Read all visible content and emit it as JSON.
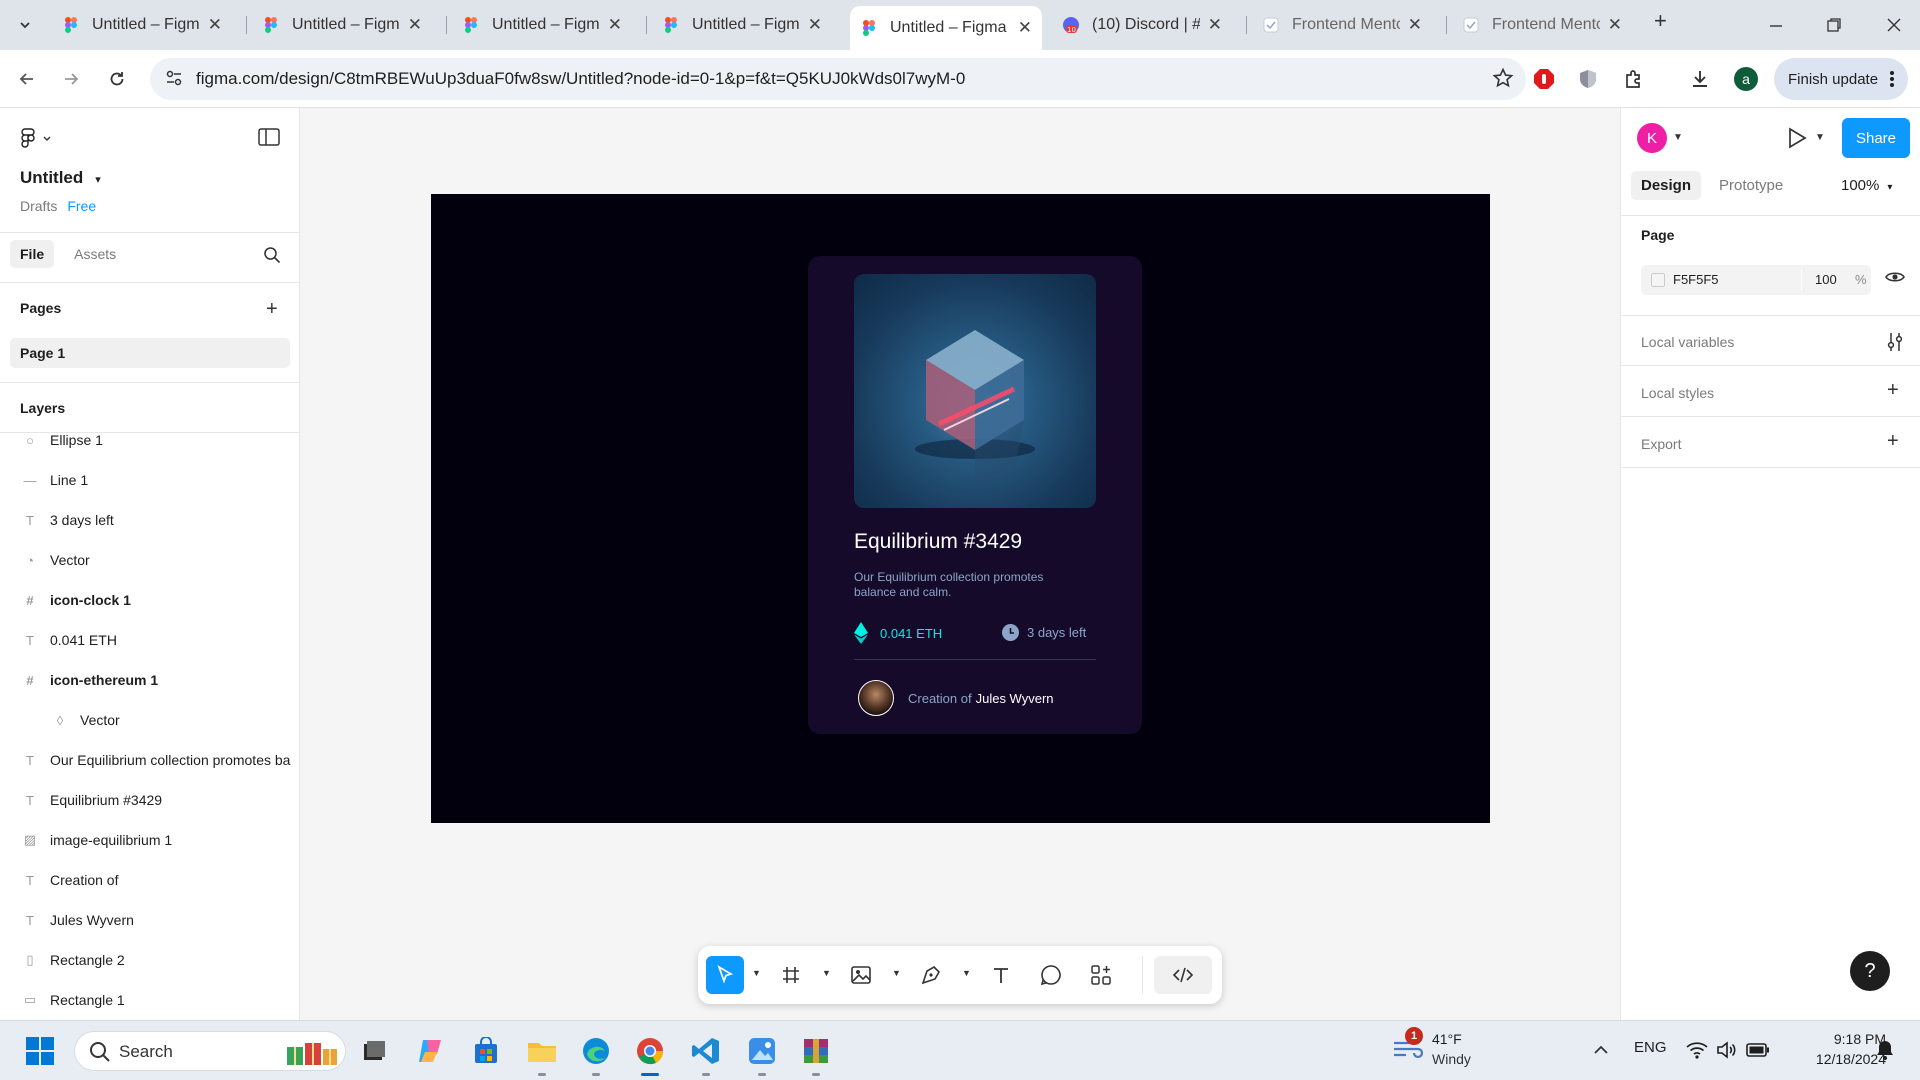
{
  "browser": {
    "tabs": [
      {
        "title": "Untitled – Figma",
        "icon": "figma-icon",
        "active": false
      },
      {
        "title": "Untitled – Figma",
        "icon": "figma-icon",
        "active": false
      },
      {
        "title": "Untitled – Figma",
        "icon": "figma-icon",
        "active": false
      },
      {
        "title": "Untitled – Figma",
        "icon": "figma-icon",
        "active": false
      },
      {
        "title": "Untitled – Figma",
        "icon": "figma-icon",
        "active": true
      },
      {
        "title": "(10) Discord | #",
        "icon": "discord-icon",
        "badge": "10",
        "active": false
      },
      {
        "title": "Frontend Mento",
        "icon": "page-icon",
        "active": false
      },
      {
        "title": "Frontend Mento",
        "icon": "page-icon",
        "active": false
      }
    ],
    "new_tab": "+",
    "url": "figma.com/design/C8tmRBEWuUp3duaF0fw8sw/Untitled?node-id=0-1&p=f&t=Q5KUJ0kWds0l7wyM-0",
    "profile_initial": "a",
    "finish_update": "Finish update"
  },
  "left_panel": {
    "file_name": "Untitled",
    "drafts": "Drafts",
    "plan": "Free",
    "tabs": [
      "File",
      "Assets"
    ],
    "pages_title": "Pages",
    "pages": [
      "Page 1"
    ],
    "layers_title": "Layers",
    "layers": [
      {
        "name": "Ellipse 1",
        "icon": "ellipse-icon",
        "bold": false,
        "indent": false
      },
      {
        "name": "Line 1",
        "icon": "line-icon",
        "bold": false,
        "indent": false
      },
      {
        "name": "3 days left",
        "icon": "text-icon",
        "bold": false,
        "indent": false
      },
      {
        "name": "Vector",
        "icon": "vector-icon",
        "bold": false,
        "indent": false
      },
      {
        "name": "icon-clock 1",
        "icon": "frame-icon",
        "bold": true,
        "indent": false
      },
      {
        "name": "0.041 ETH",
        "icon": "text-icon",
        "bold": false,
        "indent": false
      },
      {
        "name": "icon-ethereum 1",
        "icon": "frame-icon",
        "bold": true,
        "indent": false
      },
      {
        "name": "Vector",
        "icon": "vector-icon",
        "bold": false,
        "indent": true
      },
      {
        "name": "Our Equilibrium collection promotes ba",
        "icon": "text-icon",
        "bold": false,
        "indent": false
      },
      {
        "name": "Equilibrium #3429",
        "icon": "text-icon",
        "bold": false,
        "indent": false
      },
      {
        "name": "image-equilibrium 1",
        "icon": "image-icon",
        "bold": false,
        "indent": false
      },
      {
        "name": "Creation of",
        "icon": "text-icon",
        "bold": false,
        "indent": false
      },
      {
        "name": "Jules Wyvern",
        "icon": "text-icon",
        "bold": false,
        "indent": false
      },
      {
        "name": "Rectangle 2",
        "icon": "rectangle-icon",
        "bold": false,
        "indent": false
      },
      {
        "name": "Rectangle 1",
        "icon": "rectangle-icon",
        "bold": false,
        "indent": false
      }
    ]
  },
  "canvas": {
    "card": {
      "title": "Equilibrium #3429",
      "description": "Our Equilibrium collection promotes balance and calm.",
      "price": "0.041 ETH",
      "time_left": "3 days left",
      "creation_prefix": "Creation of",
      "creator": "Jules Wyvern"
    }
  },
  "right_panel": {
    "profile_initial": "K",
    "share": "Share",
    "tabs": [
      "Design",
      "Prototype"
    ],
    "zoom": "100%",
    "page_title": "Page",
    "page_fill_hex": "F5F5F5",
    "page_fill_opacity": "100",
    "page_fill_unit": "%",
    "local_variables": "Local variables",
    "local_styles": "Local styles",
    "export": "Export",
    "help": "?"
  },
  "taskbar": {
    "search": "Search",
    "weather_badge": "1",
    "weather_temp": "41°F",
    "weather_cond": "Windy",
    "lang": "ENG",
    "time": "9:18 PM",
    "date": "12/18/2024"
  },
  "colors": {
    "figma_blue": "#0d99ff",
    "frame_bg": "#03000d",
    "card_bg": "#150a2a",
    "cyan": "#00f0e2",
    "soft_blue": "#8ba5c9",
    "avatar_pink": "#ee1fa5"
  }
}
